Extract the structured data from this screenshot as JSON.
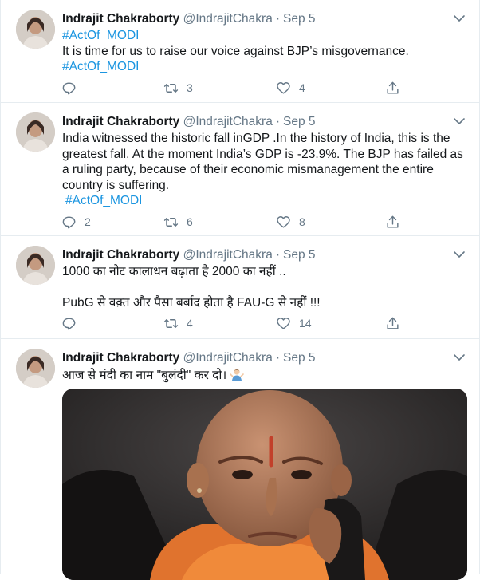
{
  "tweets": [
    {
      "author": "Indrajit Chakraborty",
      "handle": "@IndrajitChakra",
      "date": "Sep 5",
      "lines": [
        "#ActOf_MODI",
        "It is time for us to raise our voice against BJP’s misgovernance.",
        "#ActOf_MODI"
      ],
      "replies": "",
      "retweets": "3",
      "likes": "4"
    },
    {
      "author": "Indrajit Chakraborty",
      "handle": "@IndrajitChakra",
      "date": "Sep 5",
      "text": "India witnessed the historic fall inGDP .In the history of India, this is the greatest fall. At the moment India’s GDP is -23.9%. The BJP has failed as a ruling party, because of their economic mismanagement the entire country is suffering.",
      "hashtag": "#ActOf_MODI",
      "replies": "2",
      "retweets": "6",
      "likes": "8"
    },
    {
      "author": "Indrajit Chakraborty",
      "handle": "@IndrajitChakra",
      "date": "Sep 5",
      "line1": "1000 का नोट कालाधन बढ़ाता है 2000 का नहीं ..",
      "line2": "PubG से वक़्त और पैसा बर्बाद होता है FAU-G से नहीं !!!",
      "replies": "",
      "retweets": "4",
      "likes": "14"
    },
    {
      "author": "Indrajit Chakraborty",
      "handle": "@IndrajitChakra",
      "date": "Sep 5",
      "text": "आज से मंदी का नाम \"बुलंदी\" कर दो।",
      "emoji": "man-shrugging-emoji"
    }
  ],
  "colors": {
    "hashtag": "#1b95e0",
    "meta": "#657786",
    "divider": "#e6ecf0",
    "text": "#14171a"
  },
  "icons": [
    "caret-down-icon",
    "reply-icon",
    "retweet-icon",
    "like-icon",
    "share-icon",
    "avatar-photo"
  ]
}
